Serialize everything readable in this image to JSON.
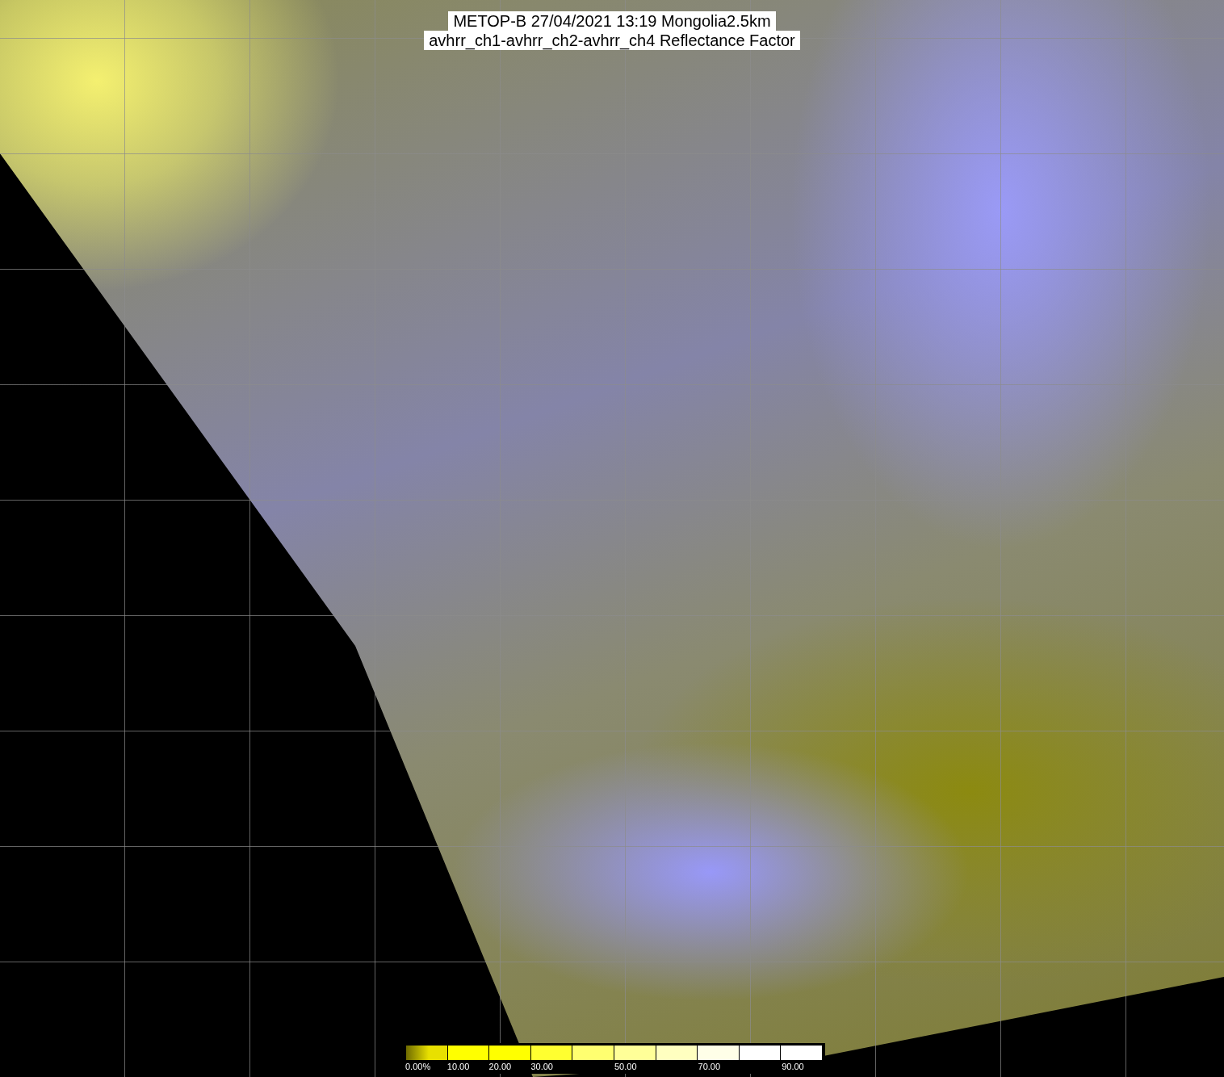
{
  "title": {
    "lines": [
      "METOP-B 27/04/2021 13:19 Mongolia2.5km",
      "avhrr_ch1-avhrr_ch2-avhrr_ch4 Reflectance Factor"
    ]
  },
  "legend": {
    "segments": [
      {
        "color": "#e8e000",
        "label": "0.00%"
      },
      {
        "color": "#ffff00",
        "label": "10.00"
      },
      {
        "color": "#ffff00",
        "label": "20.00"
      },
      {
        "color": "#ffff30",
        "label": "30.00"
      },
      {
        "color": "#ffff70"
      },
      {
        "color": "#ffff98",
        "label": "50.00"
      },
      {
        "color": "#ffffc0"
      },
      {
        "color": "#ffffe8",
        "label": "70.00"
      },
      {
        "color": "#ffffff"
      },
      {
        "color": "#ffffff",
        "label": "90.00"
      }
    ]
  }
}
